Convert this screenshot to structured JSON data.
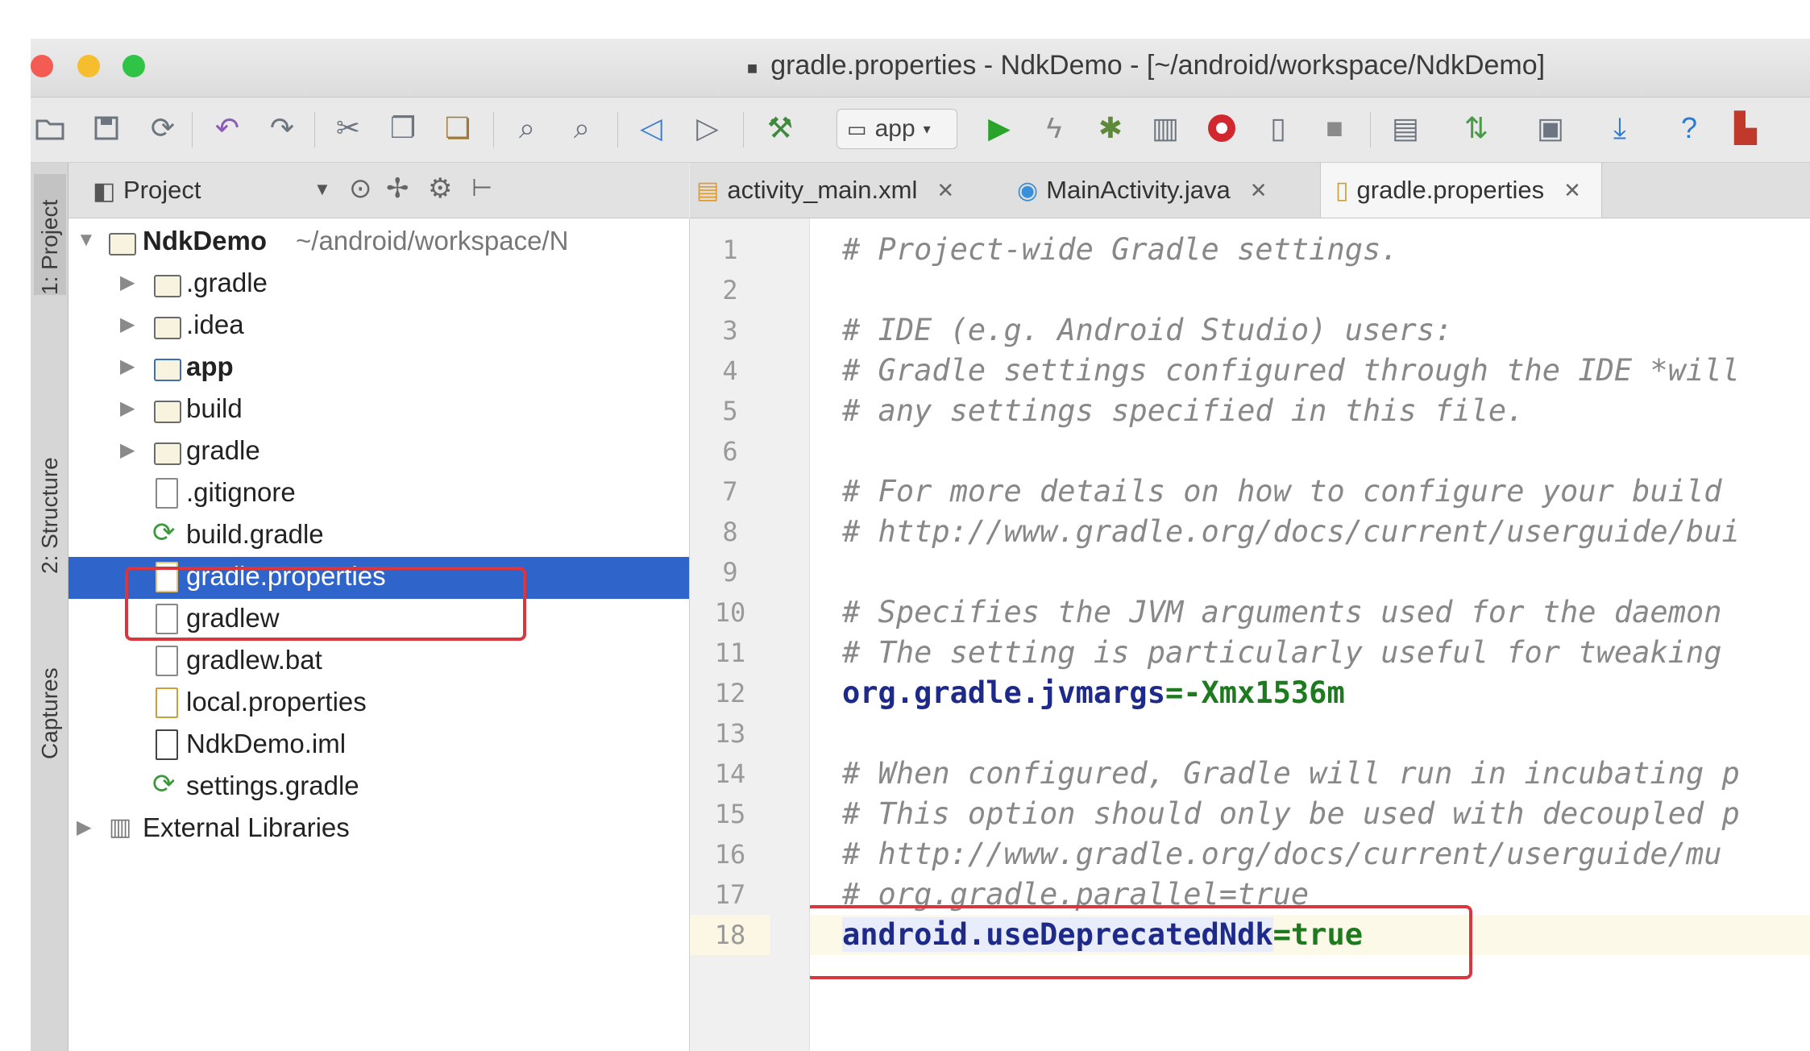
{
  "window": {
    "title": "gradle.properties - NdkDemo - [~/android/workspace/NdkDemo]"
  },
  "colors": {
    "selection": "#2f65ca",
    "highlight_box": "#d9363e",
    "comment": "#888888",
    "property_key": "#1d2a8a",
    "property_value": "#1e7a1e"
  },
  "toolbar": {
    "icons": [
      "open-folder-icon",
      "save-icon",
      "sync-icon",
      "undo-icon",
      "redo-icon",
      "cut-icon",
      "copy-icon",
      "paste-icon",
      "find-icon",
      "replace-icon",
      "back-icon",
      "forward-icon",
      "make-project-icon",
      "run-icon",
      "instant-run-icon",
      "debug-icon",
      "profile-icon",
      "stop-record-icon",
      "device-icon",
      "stop-icon",
      "sdk-manager-icon",
      "gradle-sync-icon",
      "avd-manager-icon",
      "download-icon",
      "help-icon",
      "android-monitor-icon"
    ],
    "run_config": "app"
  },
  "side_strip": {
    "tabs": [
      "1: Project",
      "2: Structure",
      "Captures"
    ]
  },
  "project_panel": {
    "header": "Project",
    "root": {
      "name": "NdkDemo",
      "path": "~/android/workspace/N"
    },
    "items": [
      {
        "label": ".gradle",
        "type": "folder"
      },
      {
        "label": ".idea",
        "type": "folder"
      },
      {
        "label": "app",
        "type": "module"
      },
      {
        "label": "build",
        "type": "folder"
      },
      {
        "label": "gradle",
        "type": "folder"
      },
      {
        "label": ".gitignore",
        "type": "file"
      },
      {
        "label": "build.gradle",
        "type": "gradle"
      },
      {
        "label": "gradle.properties",
        "type": "properties",
        "selected": true
      },
      {
        "label": "gradlew",
        "type": "file"
      },
      {
        "label": "gradlew.bat",
        "type": "file"
      },
      {
        "label": "local.properties",
        "type": "properties"
      },
      {
        "label": "NdkDemo.iml",
        "type": "iml"
      },
      {
        "label": "settings.gradle",
        "type": "gradle"
      }
    ],
    "external": "External Libraries"
  },
  "tabs": [
    {
      "label": "activity_main.xml"
    },
    {
      "label": "MainActivity.java"
    },
    {
      "label": "gradle.properties",
      "active": true
    }
  ],
  "editor": {
    "lines": [
      {
        "n": "1",
        "text": "# Project-wide Gradle settings."
      },
      {
        "n": "2",
        "text": ""
      },
      {
        "n": "3",
        "text": "# IDE (e.g. Android Studio) users:"
      },
      {
        "n": "4",
        "text": "# Gradle settings configured through the IDE *will"
      },
      {
        "n": "5",
        "text": "# any settings specified in this file."
      },
      {
        "n": "6",
        "text": ""
      },
      {
        "n": "7",
        "text": "# For more details on how to configure your build"
      },
      {
        "n": "8",
        "text": "# http://www.gradle.org/docs/current/userguide/bui"
      },
      {
        "n": "9",
        "text": ""
      },
      {
        "n": "10",
        "text": "# Specifies the JVM arguments used for the daemon"
      },
      {
        "n": "11",
        "text": "# The setting is particularly useful for tweaking"
      },
      {
        "n": "12",
        "key": "org.gradle.jvmargs",
        "eq": "=",
        "value": "-Xmx1536m"
      },
      {
        "n": "13",
        "text": ""
      },
      {
        "n": "14",
        "text": "# When configured, Gradle will run in incubating p"
      },
      {
        "n": "15",
        "text": "# This option should only be used with decoupled p"
      },
      {
        "n": "16",
        "text": "# http://www.gradle.org/docs/current/userguide/mu"
      },
      {
        "n": "17",
        "text": "# org.gradle.parallel=true"
      },
      {
        "n": "18",
        "key": "android.useDeprecatedNdk",
        "eq": "=",
        "value": "true"
      }
    ]
  }
}
